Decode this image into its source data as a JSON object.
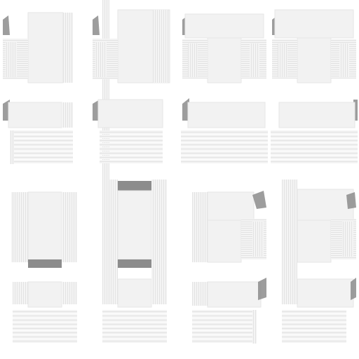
{
  "sheet": {
    "kind": "tileset",
    "columns": 4,
    "rows": 4,
    "tile_count": 16,
    "colors": {
      "background": "#ffffff",
      "tile_fill": "#f2f2f2",
      "stripe_light": "#ebebeb",
      "stripe_dark": "#dcdcdc",
      "shadow": "#8c8c8c"
    }
  },
  "tiles": [
    {
      "id": "t00",
      "variant": "corner-top-left"
    },
    {
      "id": "t01",
      "variant": "corner-top-left-pillar"
    },
    {
      "id": "t02",
      "variant": "t-junction-top"
    },
    {
      "id": "t03",
      "variant": "t-junction-top-wide"
    },
    {
      "id": "t10",
      "variant": "stair-left"
    },
    {
      "id": "t11",
      "variant": "stair-left-pillar"
    },
    {
      "id": "t12",
      "variant": "stair-wide"
    },
    {
      "id": "t13",
      "variant": "stair-wide-right"
    },
    {
      "id": "t20",
      "variant": "column-bottom-shadow"
    },
    {
      "id": "t21",
      "variant": "column-shadowed"
    },
    {
      "id": "t22",
      "variant": "corner-top-right"
    },
    {
      "id": "t23",
      "variant": "corner-top-right-wide"
    },
    {
      "id": "t30",
      "variant": "stair-center"
    },
    {
      "id": "t31",
      "variant": "stair-center-pillar"
    },
    {
      "id": "t32",
      "variant": "stair-right"
    },
    {
      "id": "t33",
      "variant": "stair-right-wide"
    }
  ]
}
